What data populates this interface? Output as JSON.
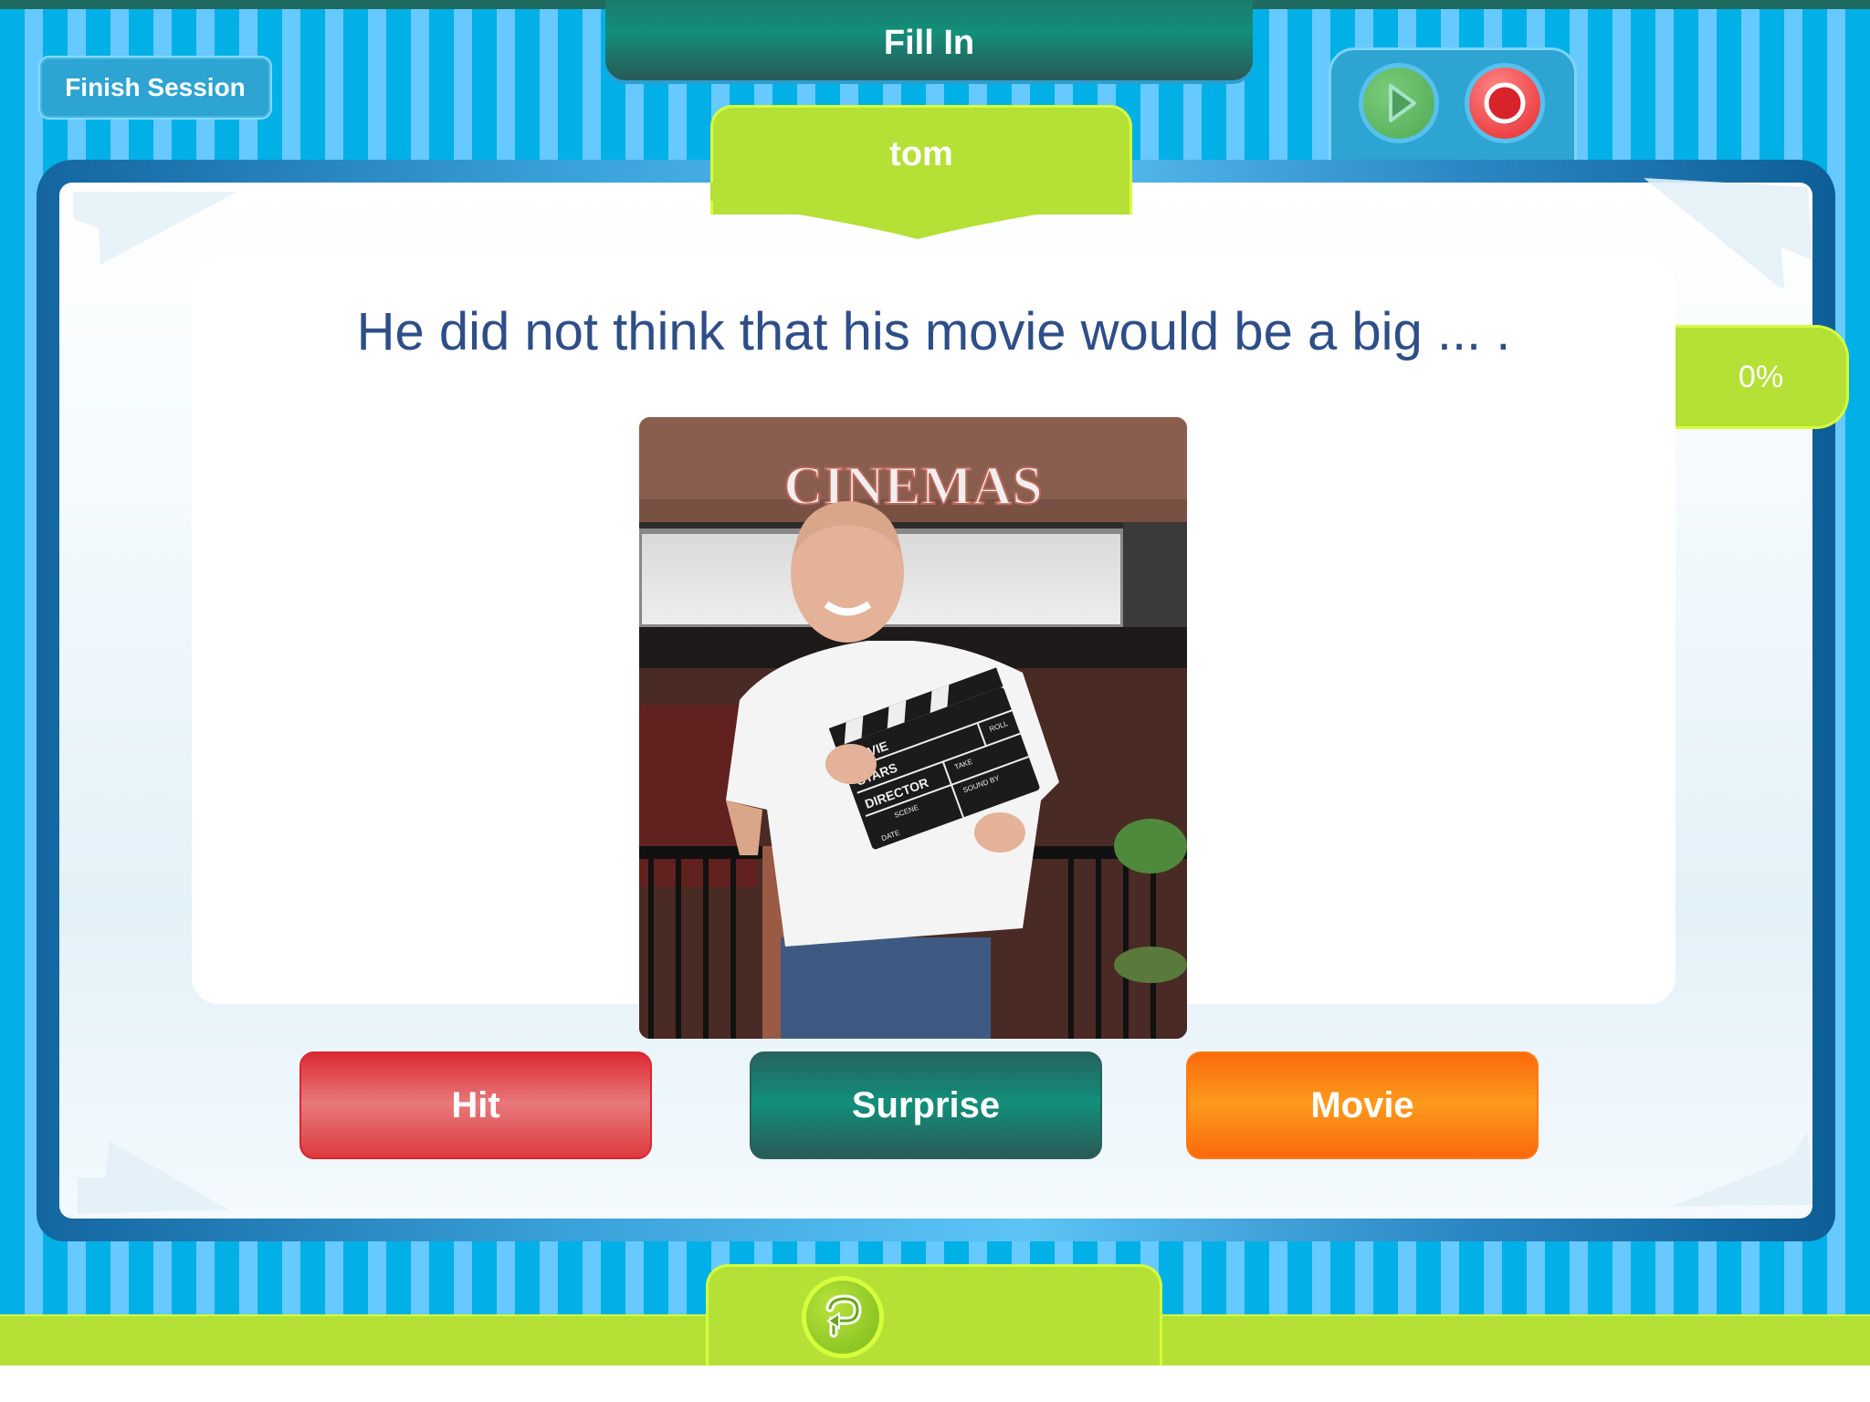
{
  "header": {
    "title": "Fill In"
  },
  "toolbar": {
    "finish_session_label": "Finish Session",
    "play_icon": "play-icon",
    "record_icon": "record-icon"
  },
  "student": {
    "name": "tom"
  },
  "progress": {
    "label": "0%",
    "value_percent": 0
  },
  "question": {
    "text": "He did not think that his movie would be a big ... ."
  },
  "image": {
    "description": "Smiling man in white shirt holding a clapperboard in front of a cinema",
    "sign_text": "CINEMAS",
    "clapperboard_labels": [
      "MOVIE",
      "STARS",
      "DIRECTOR",
      "SCENE",
      "TAKE",
      "ROLL",
      "SOUND BY",
      "DATE"
    ]
  },
  "answers": [
    {
      "label": "Hit",
      "color": "#e0464b"
    },
    {
      "label": "Surprise",
      "color": "#16806f"
    },
    {
      "label": "Movie",
      "color": "#fd8a16"
    }
  ],
  "footer": {
    "replay_icon": "replay-icon"
  },
  "colors": {
    "stripe_dark": "#00b0e6",
    "stripe_light": "#66c9ff",
    "accent_green": "#b5e036",
    "header_teal": "#12907a",
    "question_text": "#2e4e88"
  }
}
